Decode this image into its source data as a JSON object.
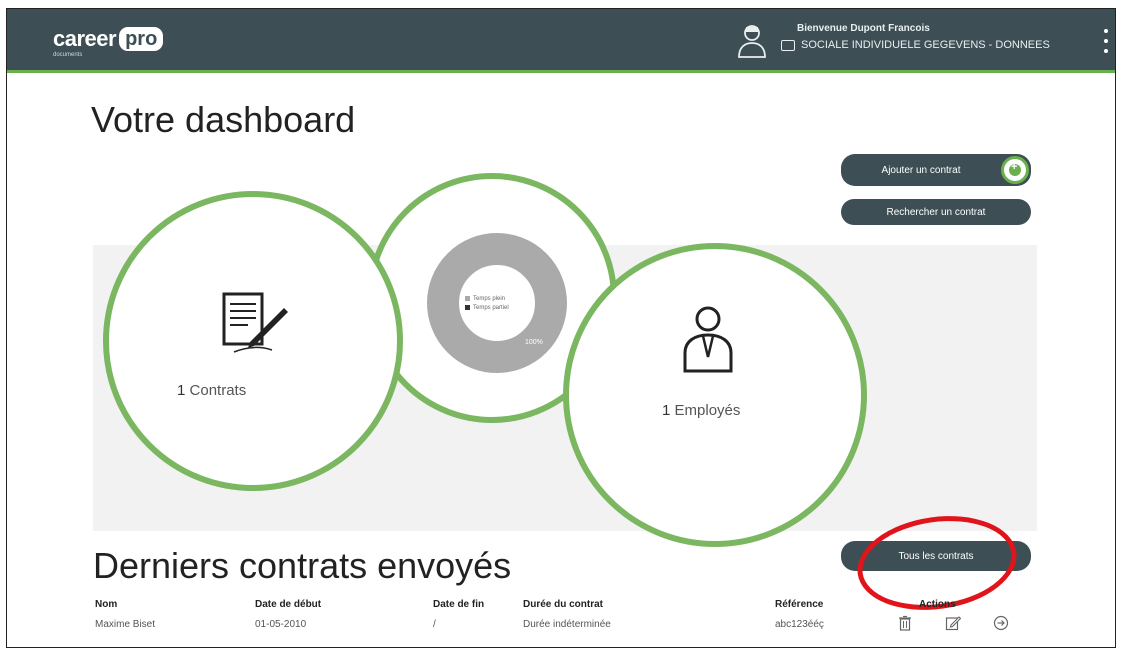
{
  "header": {
    "logo_main": "career",
    "logo_badge": "pro",
    "logo_sub": "documents",
    "welcome": "Bienvenue Dupont Francois",
    "company": "SOCIALE INDIVIDUELE GEGEVENS - DONNEES"
  },
  "page": {
    "title": "Votre dashboard"
  },
  "buttons": {
    "add_contract": "Ajouter un contrat",
    "search_contract": "Rechercher un contrat",
    "all_contracts": "Tous les contrats"
  },
  "stats": {
    "contracts_count": "1",
    "contracts_label": "Contrats",
    "employees_count": "1",
    "employees_label": "Employés"
  },
  "chart_data": {
    "type": "pie",
    "categories": [
      "Temps plein",
      "Temps partiel"
    ],
    "values": [
      100,
      0
    ],
    "labels": [
      "100%"
    ]
  },
  "recent": {
    "title": "Derniers contrats envoyés",
    "columns": [
      "Nom",
      "Date de début",
      "Date de fin",
      "Durée du contrat",
      "Référence",
      "Actions"
    ],
    "rows": [
      {
        "name": "Maxime Biset",
        "start": "01-05-2010",
        "end": "/",
        "duration": "Durée indéterminée",
        "reference": "abc123ééç"
      }
    ]
  },
  "colors": {
    "topbar": "#3d4f55",
    "accent_green": "#7bb661",
    "highlight_red": "#e0141b",
    "donut_full": "#aaaaaa",
    "donut_part": "#333333"
  },
  "icons": [
    "user-avatar-icon",
    "briefcase-icon",
    "kebab-menu-icon",
    "contract-document-icon",
    "employee-person-icon",
    "plus-icon",
    "trash-icon",
    "edit-icon",
    "open-arrow-icon"
  ]
}
